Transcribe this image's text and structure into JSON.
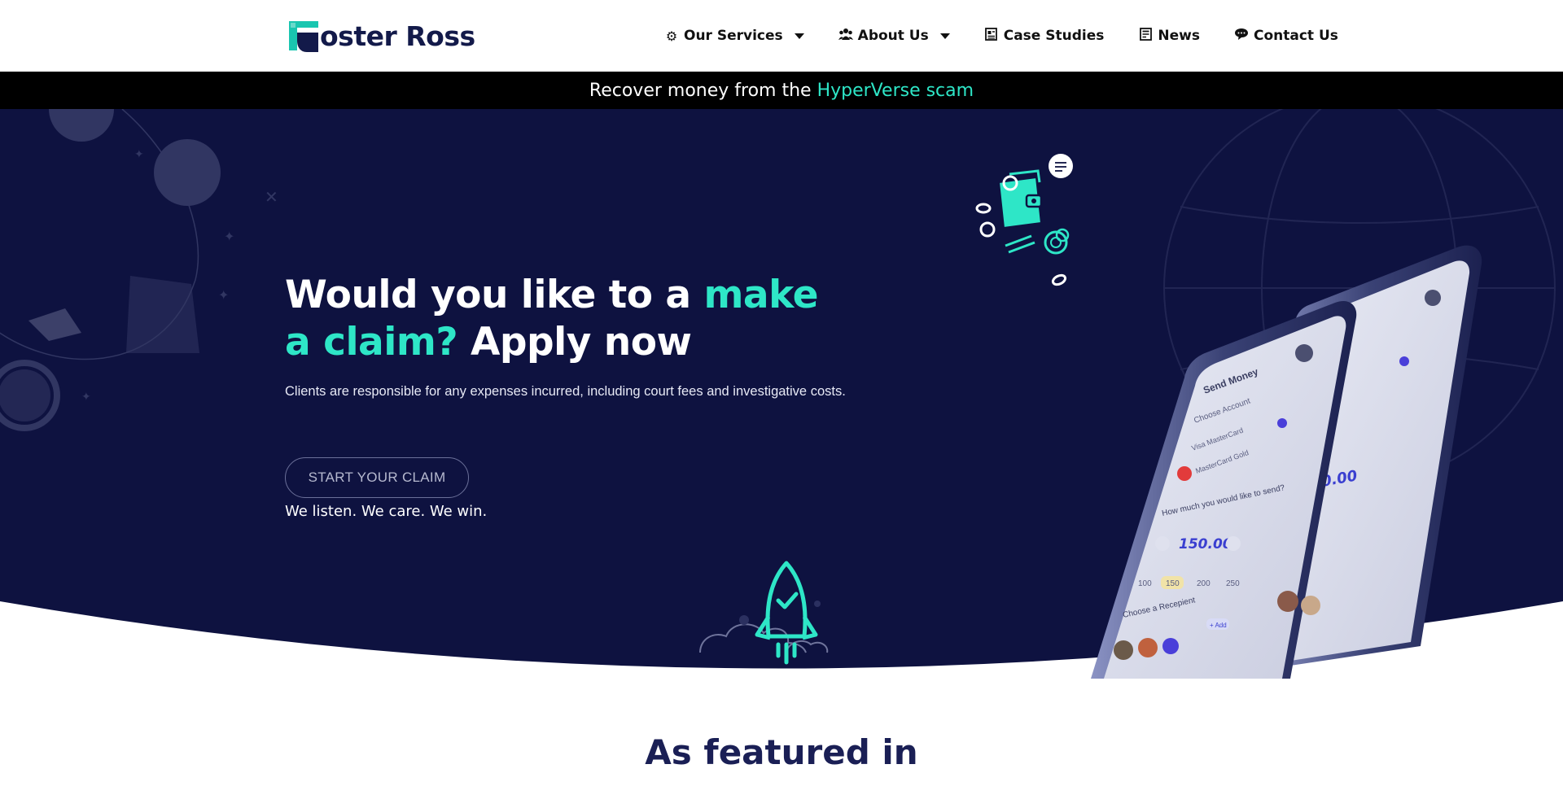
{
  "brand": {
    "name": "oster Ross",
    "logo_letter": "F"
  },
  "nav": {
    "items": [
      {
        "label": "Our Services",
        "icon": "gear-icon",
        "has_dropdown": true
      },
      {
        "label": "About Us",
        "icon": "people-icon",
        "has_dropdown": true
      },
      {
        "label": "Case Studies",
        "icon": "newspaper-icon",
        "has_dropdown": false
      },
      {
        "label": "News",
        "icon": "document-icon",
        "has_dropdown": false
      },
      {
        "label": "Contact Us",
        "icon": "chat-bubble-icon",
        "has_dropdown": false
      }
    ]
  },
  "announcement": {
    "text": "Recover money from the",
    "highlight": "HyperVerse scam"
  },
  "hero": {
    "title_part1": "Would you like to a ",
    "title_accent": "make a claim?",
    "title_part2": " Apply now",
    "subtitle": "Clients are responsible for any expenses incurred, including court fees and investigative costs.",
    "cta_label": "START YOUR CLAIM",
    "tagline": "We listen. We care. We win."
  },
  "phone_app": {
    "screen_title": "Send Money",
    "choose_account": "Choose Account",
    "account_1": "Visa MasterCard",
    "account_2": "MasterCard Gold",
    "amount_prompt": "How much you would like to send?",
    "amount": "150.00",
    "presets": [
      "100",
      "150",
      "200",
      "250"
    ],
    "recipient_label": "Choose a Recepient",
    "add_label": "+ Add"
  },
  "featured": {
    "heading": "As featured in"
  },
  "colors": {
    "navy": "#0e1240",
    "accent": "#2ee6c7",
    "header_bg": "#ffffff",
    "bar_bg": "#000000"
  }
}
